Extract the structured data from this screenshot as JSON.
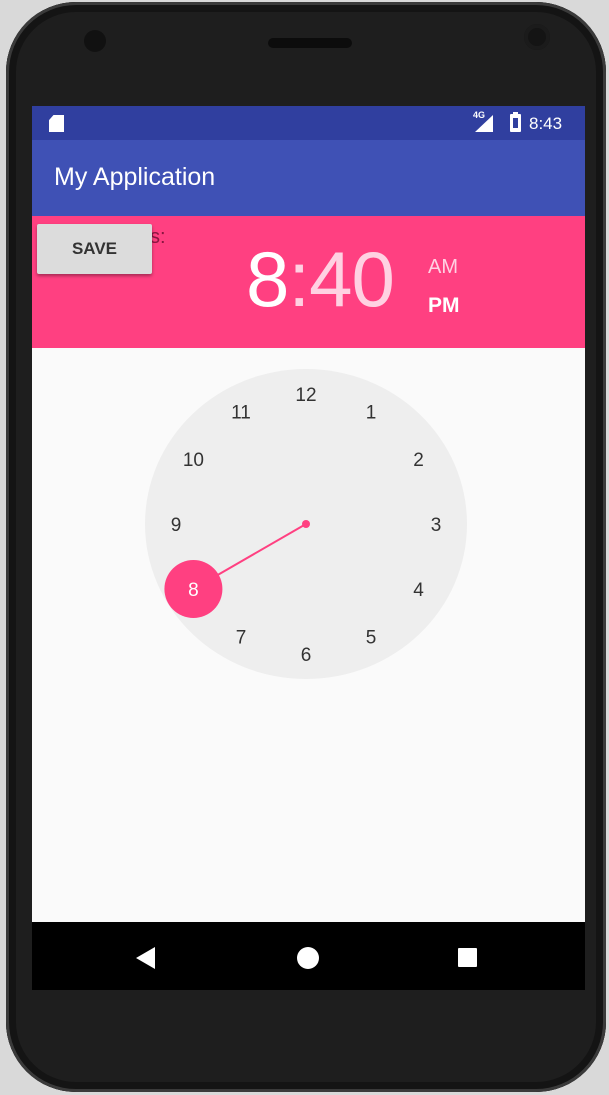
{
  "statusbar": {
    "network_type": "4G",
    "time": "8:43",
    "icons": [
      "sd-card-icon",
      "signal-icon",
      "battery-icon"
    ]
  },
  "appbar": {
    "title": "My Application"
  },
  "header": {
    "partial_label": "s:",
    "save_label": "SAVE",
    "hour": "8",
    "separator": ":",
    "minutes": "40",
    "am_label": "AM",
    "pm_label": "PM",
    "selected_period": "PM"
  },
  "clock": {
    "numbers": [
      "12",
      "1",
      "2",
      "3",
      "4",
      "5",
      "6",
      "7",
      "8",
      "9",
      "10",
      "11"
    ],
    "selected": "8"
  },
  "colors": {
    "status_bar": "#303f9f",
    "app_bar": "#3f51b5",
    "accent": "#ff4081",
    "clock_face": "#eeeeee"
  },
  "navbar": {
    "icons": [
      "back-icon",
      "home-icon",
      "recents-icon"
    ]
  }
}
